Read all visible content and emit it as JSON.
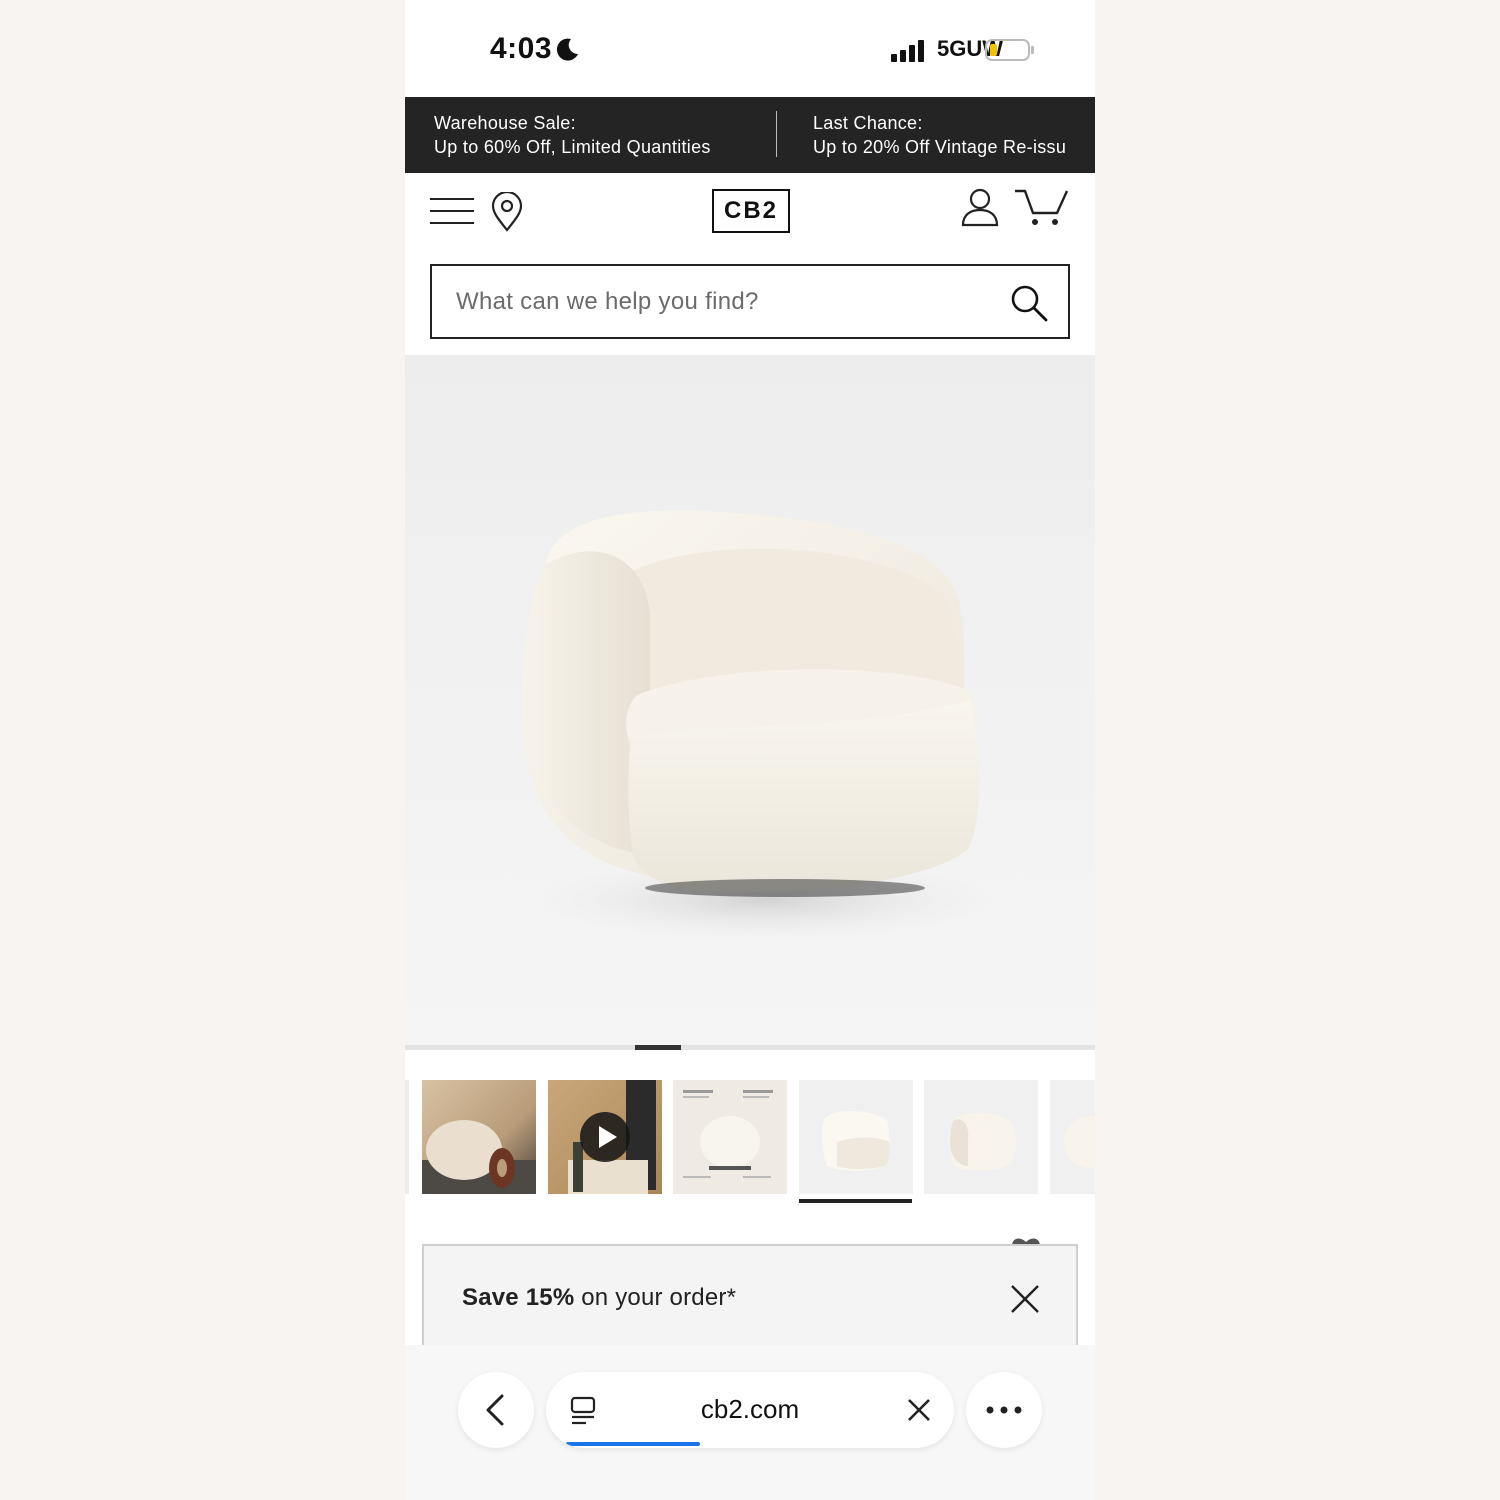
{
  "status_bar": {
    "time": "4:03",
    "network": "5GUW"
  },
  "promo_banner": {
    "items": [
      {
        "line1": "Warehouse Sale:",
        "line2": "Up to 60% Off, Limited Quantities"
      },
      {
        "line1": "Last Chance:",
        "line2": "Up to 20% Off Vintage Re-issu"
      }
    ]
  },
  "header": {
    "logo": "CB2"
  },
  "search": {
    "placeholder": "What can we help you find?"
  },
  "gallery": {
    "slide_indicator_position": 0.33,
    "thumbnails": [
      {
        "name": "lifestyle-room"
      },
      {
        "name": "video",
        "has_play_button": true
      },
      {
        "name": "feature-callouts"
      },
      {
        "name": "front-angle",
        "active": true
      },
      {
        "name": "side-angle"
      },
      {
        "name": "back-angle"
      }
    ]
  },
  "save_popup": {
    "bold_text": "Save 15%",
    "rest_text": " on your order*"
  },
  "browser": {
    "url": "cb2.com",
    "load_progress": 0.33,
    "accent": "#1a73e8"
  }
}
